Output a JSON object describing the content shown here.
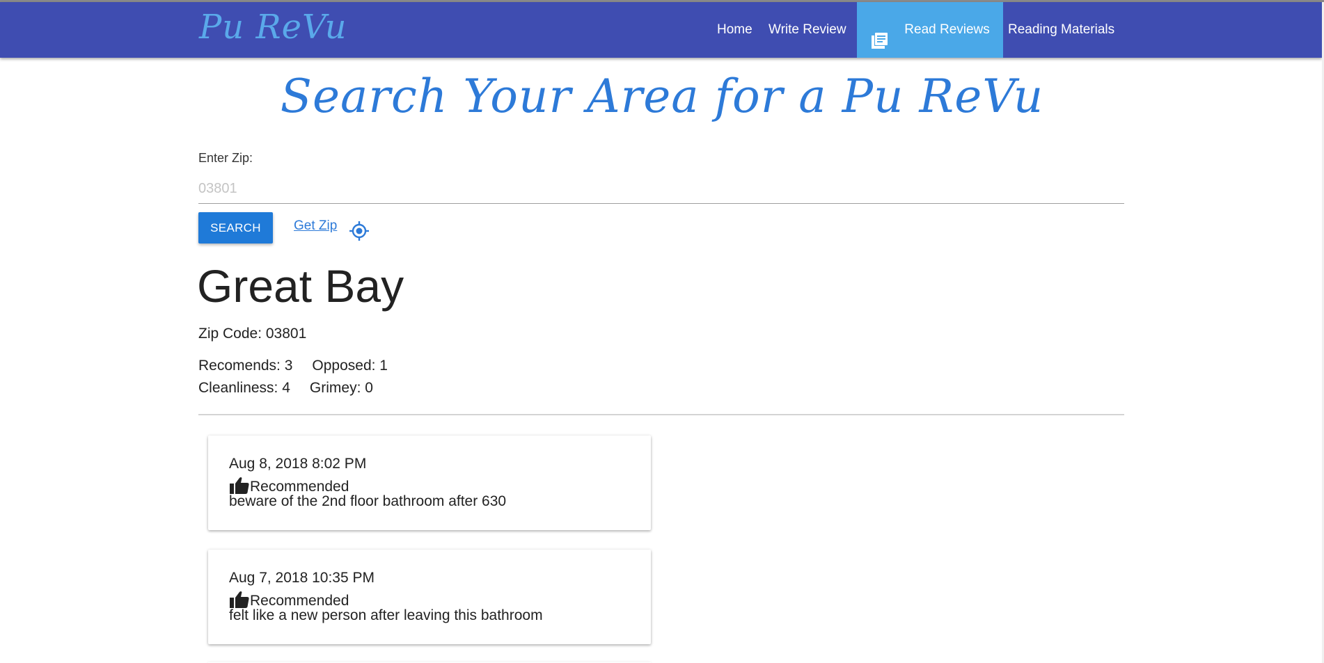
{
  "nav": {
    "brand": "Pu ReVu",
    "items": [
      {
        "label": "Home"
      },
      {
        "label": "Write Review"
      },
      {
        "label": "Read Reviews",
        "active": true
      },
      {
        "label": "Reading Materials"
      }
    ]
  },
  "page": {
    "title": "Search Your Area for a Pu ReVu"
  },
  "search": {
    "label": "Enter Zip:",
    "placeholder": "03801",
    "value": "",
    "button_label": "SEARCH",
    "get_zip_label": "Get Zip"
  },
  "area": {
    "name": "Great Bay",
    "zip_line": "Zip Code: 03801",
    "recommends": "Recomends: 3",
    "opposed": "Opposed: 1",
    "cleanliness": "Cleanliness: 4",
    "grimey": "Grimey: 0"
  },
  "reviews": [
    {
      "date": "Aug 8, 2018 8:02 PM",
      "status": "Recommended",
      "text": "beware of the 2nd floor bathroom after 630"
    },
    {
      "date": "Aug 7, 2018 10:35 PM",
      "status": "Recommended",
      "text": "felt like a new person after leaving this bathroom"
    }
  ],
  "colors": {
    "navbar": "#3f4db1",
    "nav_active": "#4aa8e8",
    "brand": "#5aa9ea",
    "accent": "#2d7ad8",
    "button": "#1f7ad8"
  },
  "icons": {
    "read_reviews": "list-document-icon",
    "locate": "crosshair-location-icon",
    "recommended": "thumbs-up-icon"
  }
}
